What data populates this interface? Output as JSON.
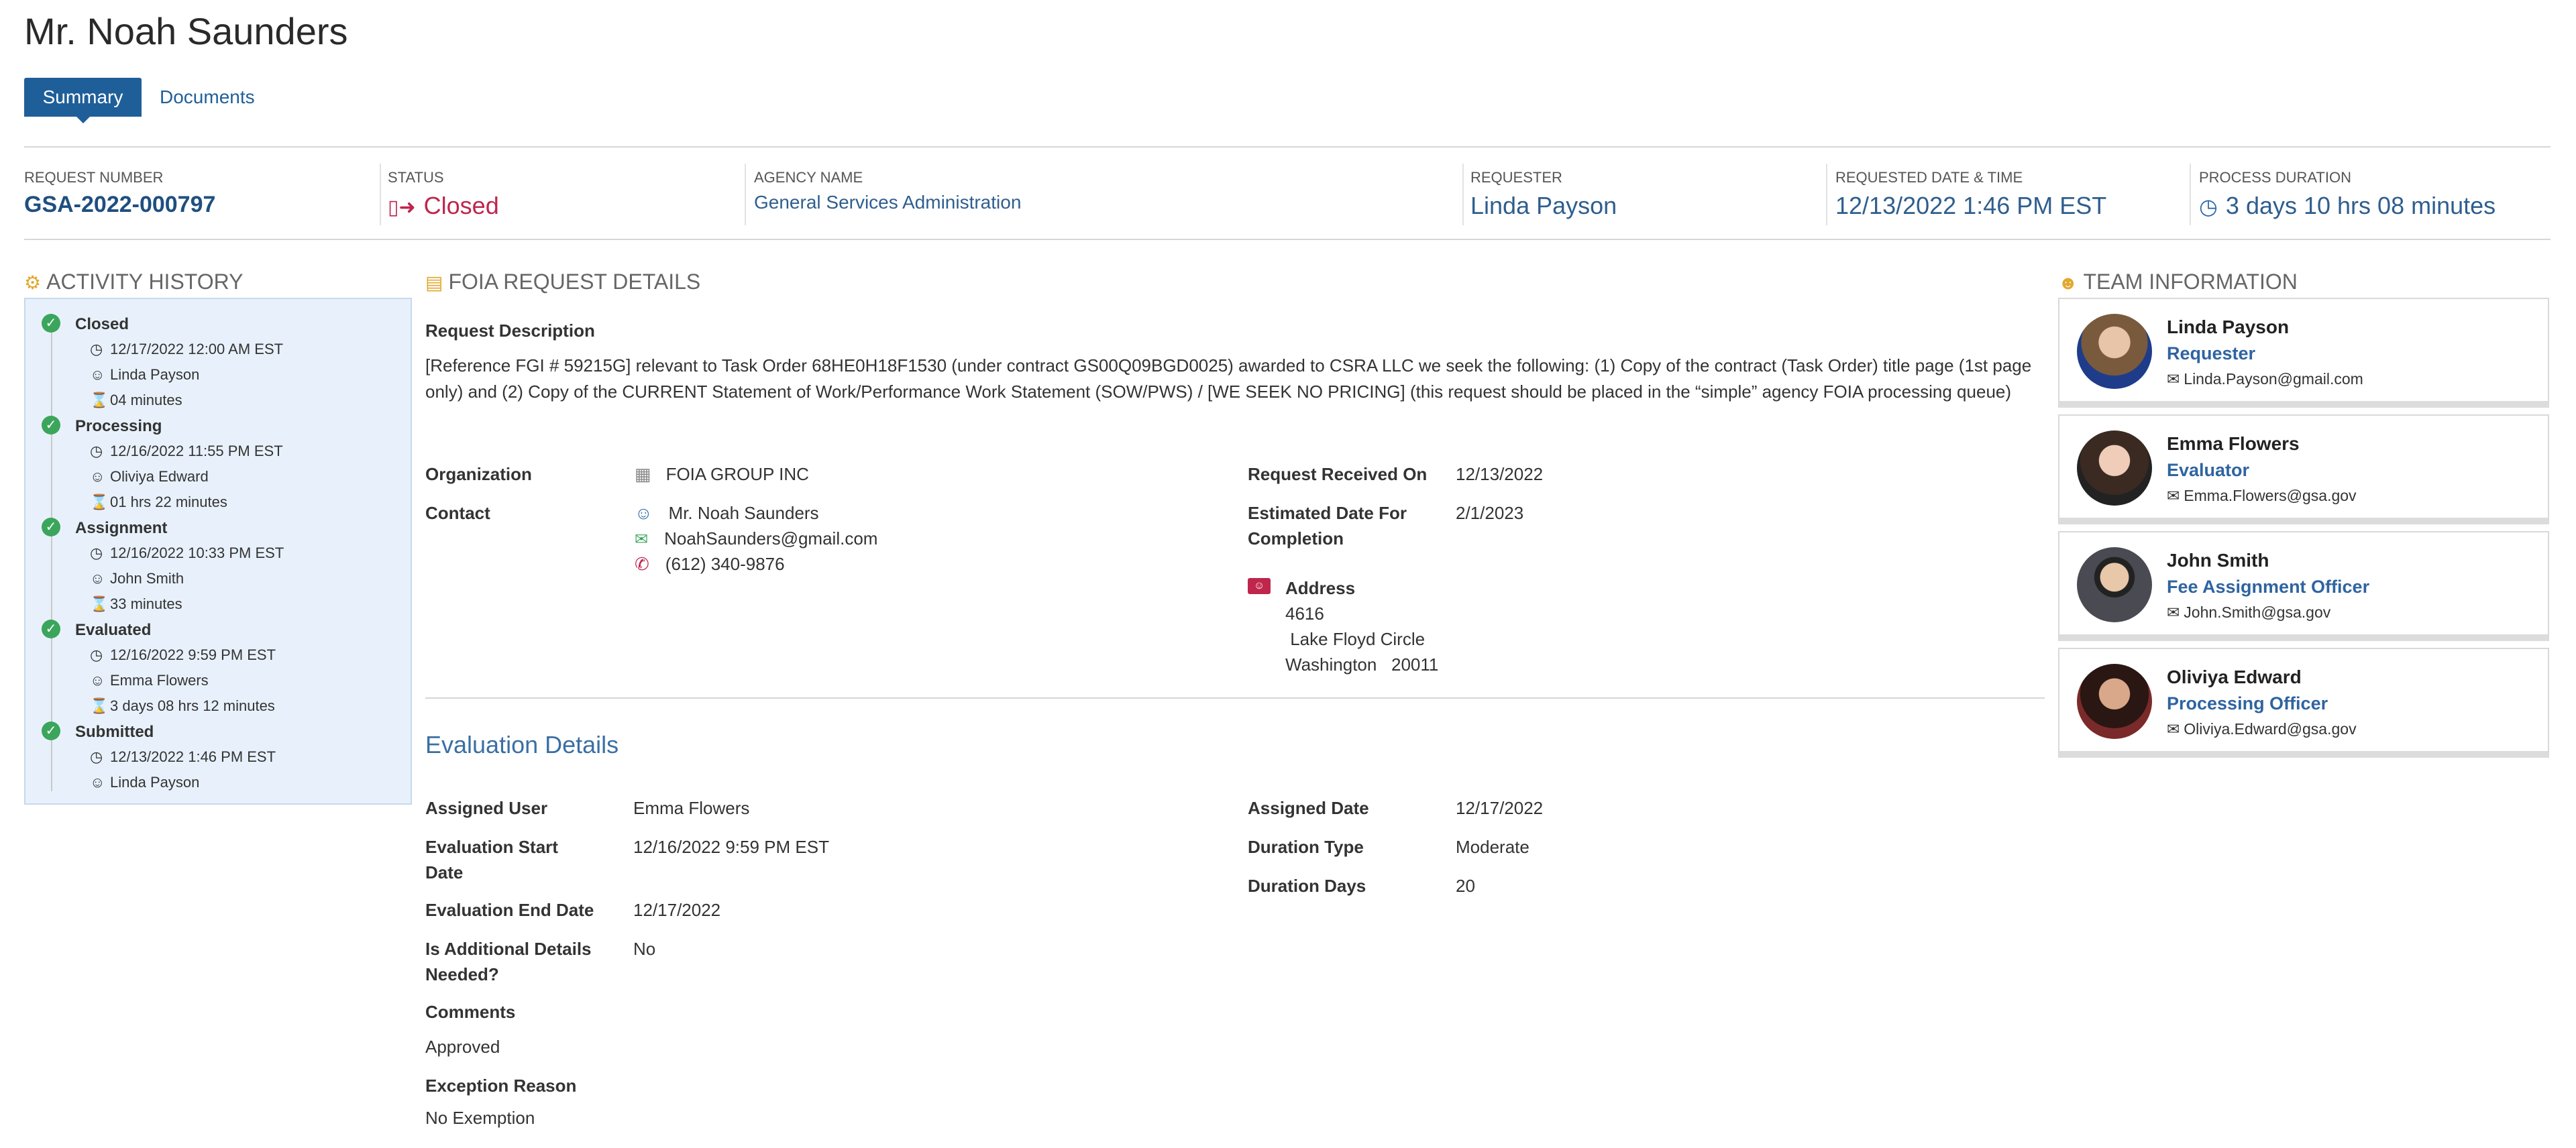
{
  "page": {
    "title": "Mr. Noah Saunders"
  },
  "tabs": [
    {
      "label": "Summary"
    },
    {
      "label": "Documents"
    }
  ],
  "meta": {
    "request_number": {
      "label": "REQUEST NUMBER",
      "value": "GSA-2022-000797"
    },
    "status": {
      "label": "STATUS",
      "value": "Closed"
    },
    "agency": {
      "label": "AGENCY NAME",
      "value": "General Services Administration"
    },
    "requester": {
      "label": "REQUESTER",
      "value": "Linda Payson"
    },
    "requested": {
      "label": "REQUESTED DATE & TIME",
      "value": "12/13/2022 1:46 PM EST"
    },
    "duration": {
      "label": "PROCESS DURATION",
      "value": "3 days 10 hrs 08 minutes"
    }
  },
  "activity": {
    "heading": "ACTIVITY HISTORY",
    "items": [
      {
        "title": "Closed",
        "date": "12/17/2022 12:00 AM EST",
        "user": "Linda Payson",
        "time": "04 minutes"
      },
      {
        "title": "Processing",
        "date": "12/16/2022 11:55 PM EST",
        "user": "Oliviya Edward",
        "time": "01 hrs 22 minutes"
      },
      {
        "title": "Assignment",
        "date": "12/16/2022 10:33 PM EST",
        "user": "John Smith",
        "time": "33 minutes"
      },
      {
        "title": "Evaluated",
        "date": "12/16/2022 9:59 PM EST",
        "user": "Emma Flowers",
        "time": "3 days 08 hrs 12 minutes"
      },
      {
        "title": "Submitted",
        "date": "12/13/2022 1:46 PM EST",
        "user": "Linda Payson"
      }
    ]
  },
  "foia": {
    "heading": "FOIA REQUEST DETAILS",
    "desc_label": "Request Description",
    "desc": "[Reference FGI # 59215G] relevant to Task Order 68HE0H18F1530 (under contract GS00Q09BGD0025) awarded to CSRA LLC we seek the following: (1) Copy of the contract (Task Order) title page (1st page only) and (2) Copy of the CURRENT Statement of Work/Performance Work Statement (SOW/PWS)  / [WE SEEK NO PRICING] (this request should be placed in the “simple” agency FOIA processing queue)",
    "org_label": "Organization",
    "org": "FOIA GROUP INC",
    "contact_label": "Contact",
    "contact_name": "Mr. Noah  Saunders",
    "contact_email": "NoahSaunders@gmail.com",
    "contact_phone": "(612) 340-9876",
    "received_label": "Request Received On",
    "received": "12/13/2022",
    "est_label_1": "Estimated Date For",
    "est_label_2": "Completion",
    "est": "2/1/2023",
    "addr_label": "Address",
    "addr1": "4616",
    "addr2": " Lake Floyd Circle",
    "addr3": "Washington   20011"
  },
  "evaluation": {
    "heading": "Evaluation Details",
    "assigned_user_label": "Assigned User",
    "assigned_user": "Emma Flowers",
    "start_label_1": "Evaluation Start",
    "start_label_2": "Date",
    "start": "12/16/2022 9:59 PM EST",
    "end_label": "Evaluation End Date",
    "end": "12/17/2022",
    "addl_label_1": "Is Additional Details",
    "addl_label_2": "Needed?",
    "addl": "No",
    "comments_label": "Comments",
    "comments": "Approved",
    "exception_label": "Exception Reason",
    "exception": "No Exemption",
    "assigned_date_label": "Assigned Date",
    "assigned_date": "12/17/2022",
    "dtype_label": "Duration Type",
    "dtype": "Moderate",
    "ddays_label": "Duration Days",
    "ddays": "20"
  },
  "team": {
    "heading": "TEAM INFORMATION",
    "members": [
      {
        "name": "Linda Payson",
        "role": "Requester",
        "email": "Linda.Payson@gmail.com",
        "color": "#7a5a3c"
      },
      {
        "name": "Emma Flowers",
        "role": "Evaluator",
        "email": "Emma.Flowers@gsa.gov",
        "color": "#3a2a22"
      },
      {
        "name": "John Smith",
        "role": "Fee Assignment Officer",
        "email": "John.Smith@gsa.gov",
        "color": "#4a4a52"
      },
      {
        "name": "Oliviya Edward",
        "role": "Processing Officer",
        "email": "Oliviya.Edward@gsa.gov",
        "color": "#7a2a2a"
      }
    ]
  },
  "colors": {
    "accent": "#1f5f99",
    "status_closed": "#c0254c",
    "check_green": "#3ba55c"
  },
  "icons": [
    "clock-icon",
    "user-icon",
    "hourglass-icon",
    "check-circle-icon",
    "building-icon",
    "mail-icon",
    "phone-icon",
    "address-card-icon",
    "users-icon",
    "history-icon",
    "card-icon",
    "exit-icon"
  ]
}
